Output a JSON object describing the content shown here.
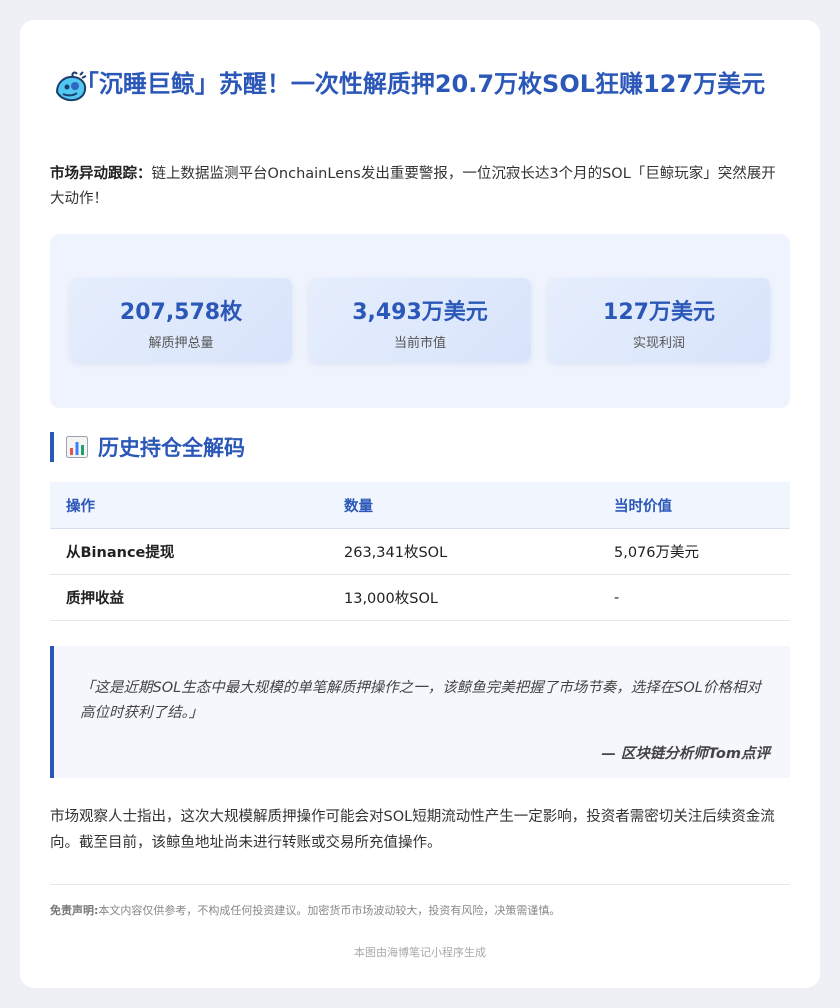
{
  "header": {
    "icon": "whale-icon",
    "title": "「沉睡巨鲸」苏醒！一次性解质押20.7万枚SOL狂赚127万美元"
  },
  "intro": {
    "label": "市场异动跟踪：",
    "text": "链上数据监测平台OnchainLens发出重要警报，一位沉寂长达3个月的SOL「巨鲸玩家」突然展开大动作！"
  },
  "stats": [
    {
      "value": "207,578枚",
      "label": "解质押总量"
    },
    {
      "value": "3,493万美元",
      "label": "当前市值"
    },
    {
      "value": "127万美元",
      "label": "实现利润"
    }
  ],
  "section": {
    "icon": "bar-chart-icon",
    "title": "历史持仓全解码"
  },
  "table": {
    "headers": [
      "操作",
      "数量",
      "当时价值"
    ],
    "rows": [
      [
        "从Binance提现",
        "263,341枚SOL",
        "5,076万美元"
      ],
      [
        "质押收益",
        "13,000枚SOL",
        "-"
      ]
    ]
  },
  "quote": {
    "text": "「这是近期SOL生态中最大规模的单笔解质押操作之一，该鲸鱼完美把握了市场节奏，选择在SOL价格相对高位时获利了结。」",
    "author": "— 区块链分析师Tom点评"
  },
  "body": {
    "text": "市场观察人士指出，这次大规模解质押操作可能会对SOL短期流动性产生一定影响，投资者需密切关注后续资金流向。截至目前，该鲸鱼地址尚未进行转账或交易所充值操作。"
  },
  "disclaimer": {
    "label": "免责声明:",
    "text": "本文内容仅供参考，不构成任何投资建议。加密货币市场波动较大，投资有风险，决策需谨慎。"
  },
  "footer": {
    "text": "本图由海博笔记小程序生成"
  },
  "colors": {
    "accent": "#2a57b8",
    "panel": "#eef3fd",
    "card": "#ffffff",
    "background": "#eef0f5"
  }
}
